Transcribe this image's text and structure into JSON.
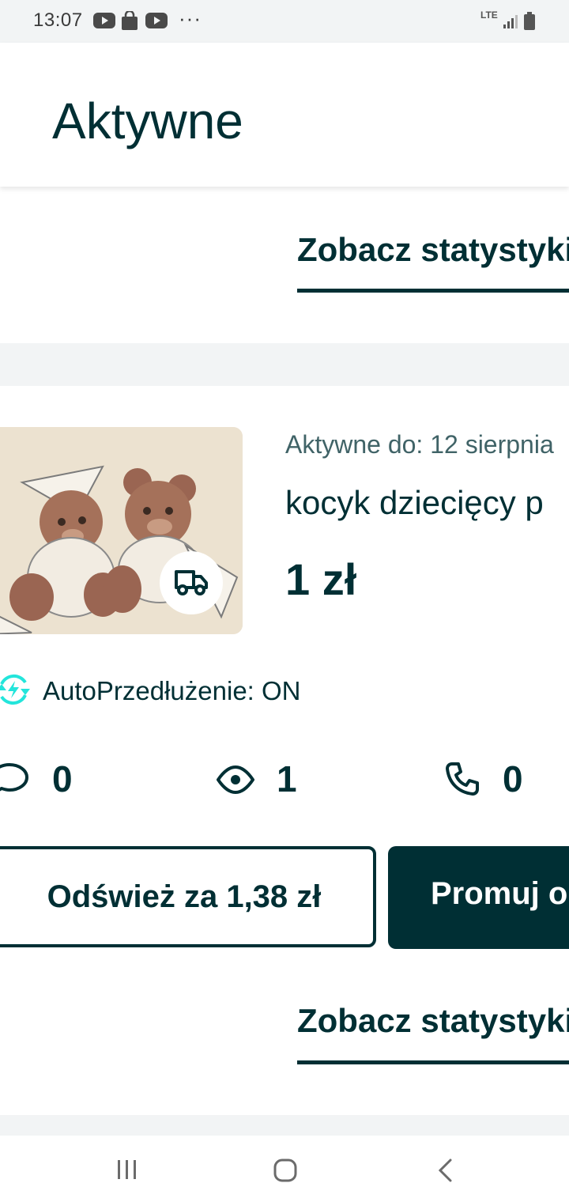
{
  "status_bar": {
    "time": "13:07",
    "icons": [
      "youtube-icon",
      "shopping-bag-icon",
      "youtube-icon",
      "more-dots-icon"
    ],
    "more": "···",
    "network": "LTE",
    "right_icons": [
      "signal-icon",
      "battery-icon"
    ]
  },
  "header": {
    "title": "Aktywne"
  },
  "top_link": {
    "label": "Zobacz statystyki"
  },
  "ad_card": {
    "active_until": "Aktywne do: 12 sierpnia",
    "title": "kocyk dziecięcy p",
    "price": "1 zł",
    "auto_renew": "AutoPrzedłużenie: ON",
    "stats": {
      "messages": "0",
      "views": "1",
      "calls": "0"
    },
    "refresh_button": "Odśwież za 1,38 zł",
    "promote_button": "Promuj o",
    "see_stats": "Zobacz statystyki"
  },
  "colors": {
    "brand_dark": "#002f34",
    "muted_text": "#406367",
    "band_gray": "#f2f4f5",
    "accent_teal": "#23e5db"
  },
  "nav_bar": {
    "icons": [
      "recent-apps-icon",
      "home-icon",
      "back-icon"
    ]
  }
}
